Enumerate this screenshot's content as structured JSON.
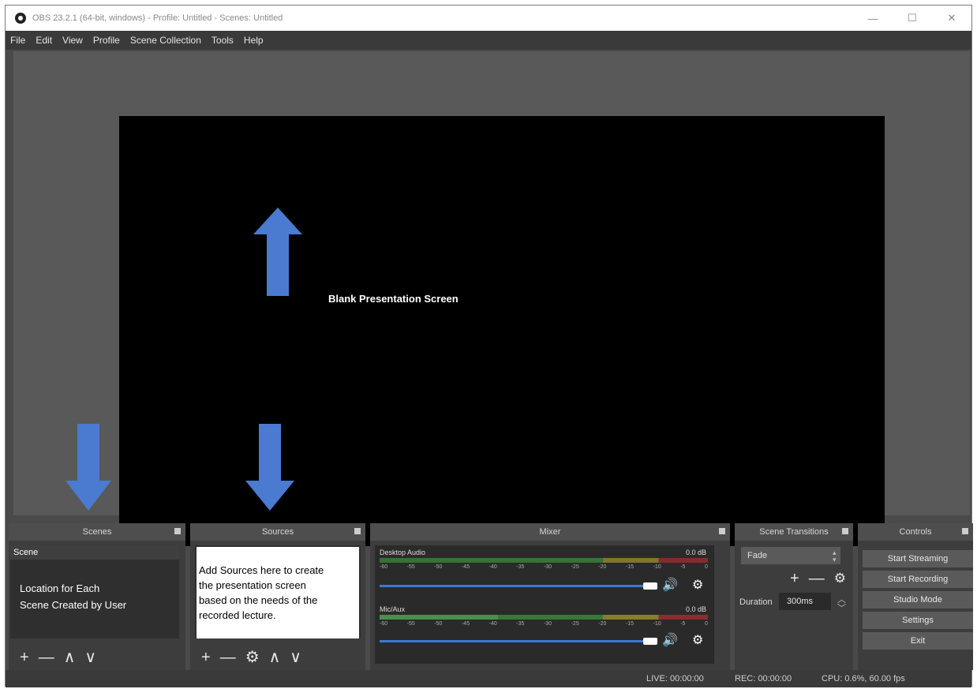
{
  "window": {
    "title": "OBS 23.2.1 (64-bit, windows) - Profile: Untitled - Scenes: Untitled",
    "minimize": "—",
    "maximize": "☐",
    "close": "✕"
  },
  "menu": [
    "File",
    "Edit",
    "View",
    "Profile",
    "Scene Collection",
    "Tools",
    "Help"
  ],
  "preview": {
    "annotation": "Blank Presentation Screen"
  },
  "scenes": {
    "title": "Scenes",
    "items": [
      "Scene"
    ],
    "annotation_line1": "Location for Each",
    "annotation_line2": "Scene Created by User",
    "toolbar": [
      "+",
      "—",
      "∧",
      "∨"
    ]
  },
  "sources": {
    "title": "Sources",
    "annotation_lines": [
      "Add Sources here to create",
      "the presentation screen",
      "based on the needs of the",
      "recorded lecture."
    ],
    "toolbar": [
      "+",
      "—",
      "⚙",
      "∧",
      "∨"
    ]
  },
  "mixer": {
    "title": "Mixer",
    "channels": [
      {
        "name": "Desktop Audio",
        "db": "0.0 dB"
      },
      {
        "name": "Mic/Aux",
        "db": "0.0 dB"
      }
    ],
    "ticks": [
      "-60",
      "-55",
      "-50",
      "-45",
      "-40",
      "-35",
      "-30",
      "-25",
      "-20",
      "-15",
      "-10",
      "-5",
      "0"
    ],
    "volume_icon": "speaker-icon",
    "settings_icon": "gear-icon"
  },
  "transitions": {
    "title": "Scene Transitions",
    "selected": "Fade",
    "duration_label": "Duration",
    "duration_value": "300ms"
  },
  "controls": {
    "title": "Controls",
    "buttons": [
      "Start Streaming",
      "Start Recording",
      "Studio Mode",
      "Settings",
      "Exit"
    ]
  },
  "status": {
    "live": "LIVE: 00:00:00",
    "rec": "REC: 00:00:00",
    "cpu": "CPU: 0.6%, 60.00 fps"
  },
  "colors": {
    "arrow": "#4a7bd0",
    "panel_bg": "#3d3d3d",
    "meter_green": "#3fae3f",
    "meter_yellow": "#c8b42c",
    "meter_red": "#c83030",
    "fader": "#3b78d8"
  }
}
